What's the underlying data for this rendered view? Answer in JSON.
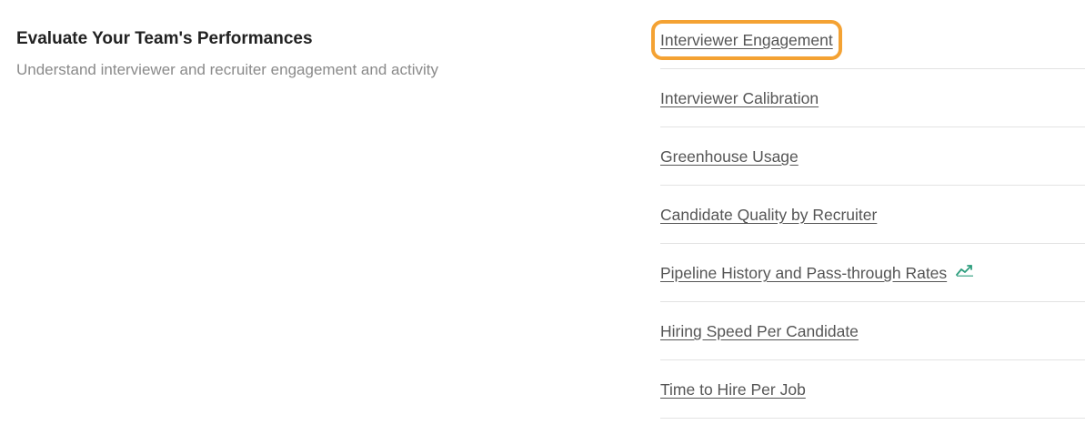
{
  "section": {
    "title": "Evaluate Your Team's Performances",
    "subtitle": "Understand interviewer and recruiter engagement and activity"
  },
  "reports": [
    {
      "label": "Interviewer Engagement",
      "highlighted": true,
      "icon": ""
    },
    {
      "label": "Interviewer Calibration",
      "highlighted": false,
      "icon": ""
    },
    {
      "label": "Greenhouse Usage",
      "highlighted": false,
      "icon": ""
    },
    {
      "label": "Candidate Quality by Recruiter",
      "highlighted": false,
      "icon": ""
    },
    {
      "label": "Pipeline History and Pass-through Rates",
      "highlighted": false,
      "icon": "trend-chart-icon"
    },
    {
      "label": "Hiring Speed Per Candidate",
      "highlighted": false,
      "icon": ""
    },
    {
      "label": "Time to Hire Per Job",
      "highlighted": false,
      "icon": ""
    }
  ],
  "colors": {
    "highlight": "#f4a233",
    "icon": "#2e9e7e",
    "link": "#555555",
    "subtitle": "#8a8a8a",
    "divider": "#e3e3e3"
  }
}
